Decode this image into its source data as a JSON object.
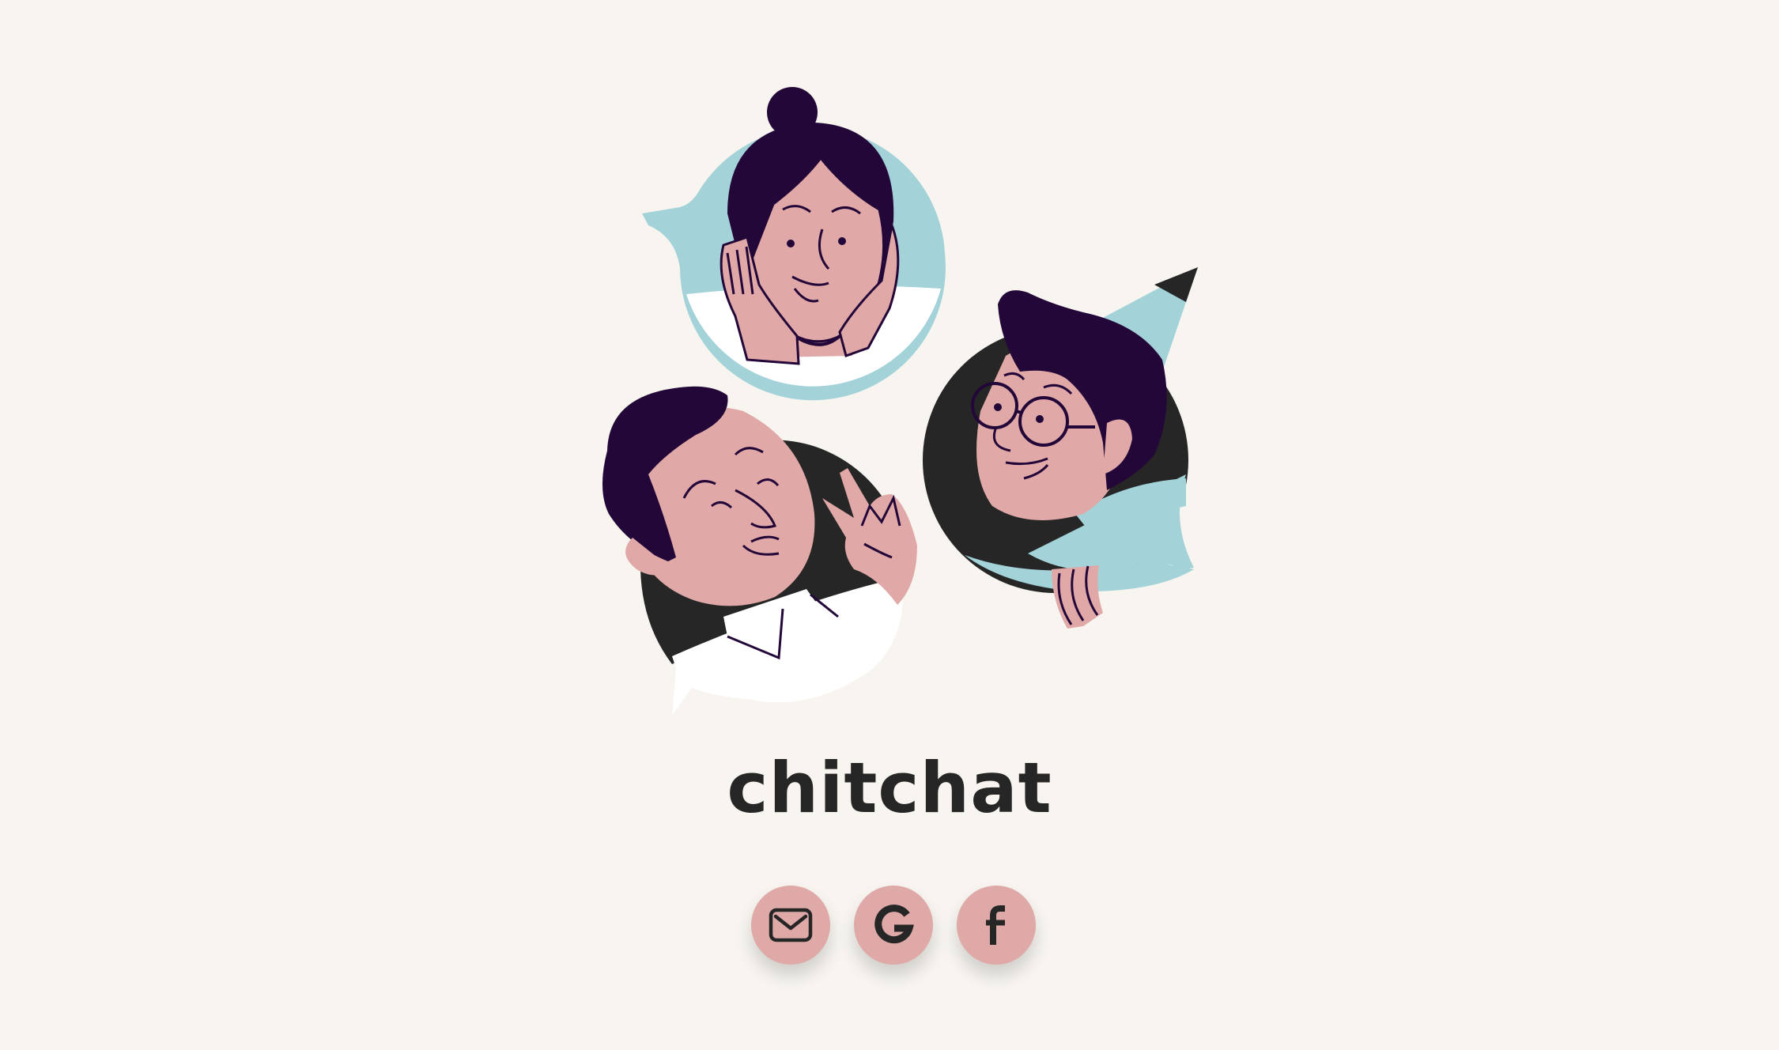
{
  "app": {
    "title": "chitchat"
  },
  "auth": {
    "buttons": [
      {
        "id": "email",
        "icon": "envelope-icon"
      },
      {
        "id": "google",
        "icon": "google-g-icon"
      },
      {
        "id": "facebook",
        "icon": "facebook-f-icon"
      }
    ]
  },
  "colors": {
    "background": "#f8f5f0",
    "title_text": "#262626",
    "button_fill": "#dfa9a7",
    "hair": "#220738",
    "skin": "#e0a9a7",
    "bubble_blue": "#a3d2d9",
    "bubble_dark": "#262626",
    "bubble_white": "#ffffff"
  }
}
